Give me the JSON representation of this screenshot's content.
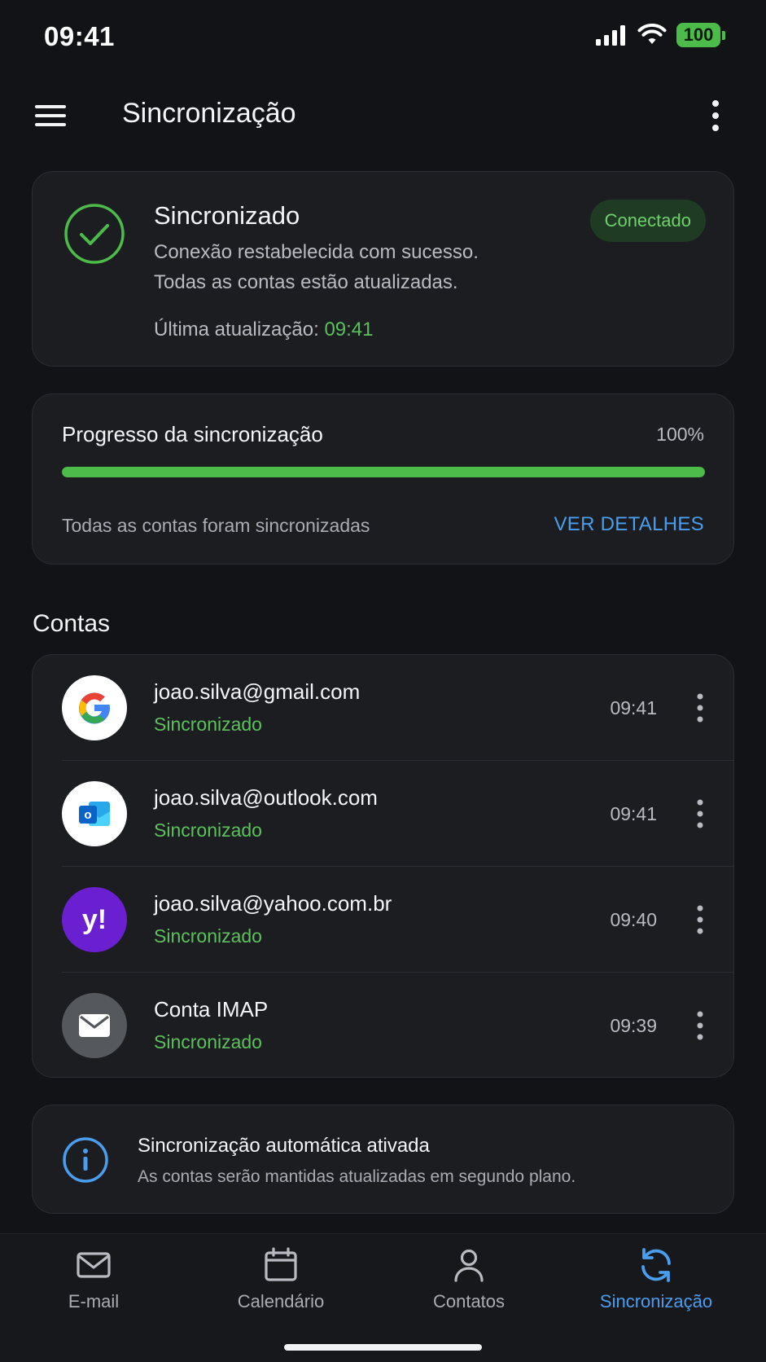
{
  "status_bar": {
    "time": "09:41",
    "battery_level": "100",
    "icons": [
      "signal-icon",
      "wifi-icon",
      "battery-icon"
    ]
  },
  "app_bar": {
    "title": "Sincronização",
    "icons": [
      "menu-icon",
      "more-vert-icon"
    ]
  },
  "sync_status": {
    "title": "Sincronizado",
    "line1": "Conexão restabelecida com sucesso.",
    "line2": "Todas as contas estão atualizadas.",
    "last_update_label": "Última atualização:",
    "last_update_time": "09:41",
    "badge": "Conectado",
    "icon": "check-circle-icon"
  },
  "progress": {
    "title": "Progresso da sincronização",
    "percent_label": "100%",
    "value": 1.0,
    "subtitle": "Todas as contas foram sincronizadas",
    "link": "VER DETALHES"
  },
  "accounts_section": {
    "title": "Contas",
    "items": [
      {
        "email": "joao.silva@gmail.com",
        "status": "Sincronizado",
        "time": "09:41",
        "icon": "google-icon"
      },
      {
        "email": "joao.silva@outlook.com",
        "status": "Sincronizado",
        "time": "09:41",
        "icon": "outlook-icon"
      },
      {
        "email": "joao.silva@yahoo.com.br",
        "status": "Sincronizado",
        "time": "09:40",
        "icon": "yahoo-icon"
      },
      {
        "email": "Conta IMAP",
        "status": "Sincronizado",
        "time": "09:39",
        "icon": "mail-icon"
      }
    ]
  },
  "auto_sync": {
    "title": "Sincronização automática ativada",
    "subtitle": "As contas serão mantidas atualizadas em segundo plano.",
    "icon": "info-icon"
  },
  "bottom_nav": {
    "items": [
      {
        "label": "E-mail",
        "icon": "mail-icon",
        "active": false
      },
      {
        "label": "Calendário",
        "icon": "calendar-icon",
        "active": false
      },
      {
        "label": "Contatos",
        "icon": "person-icon",
        "active": false
      },
      {
        "label": "Sincronização",
        "icon": "sync-icon",
        "active": true
      }
    ]
  },
  "colors": {
    "background": "#121316",
    "card": "#1b1d21",
    "accent_green": "#4cbb4a",
    "accent_blue": "#4a9ef0",
    "badge_bg": "#1f3b24"
  }
}
